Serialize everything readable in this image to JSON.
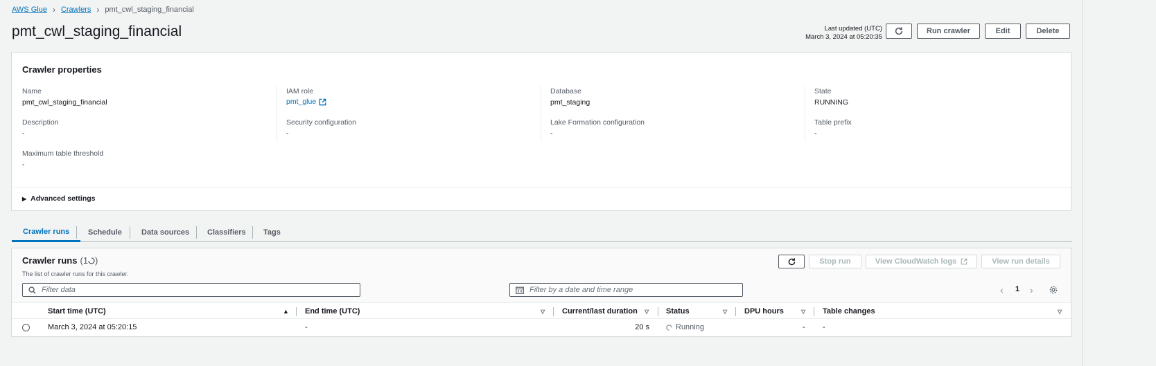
{
  "breadcrumb": {
    "root": "AWS Glue",
    "parent": "Crawlers",
    "current": "pmt_cwl_staging_financial"
  },
  "page": {
    "title": "pmt_cwl_staging_financial"
  },
  "header": {
    "last_updated_label": "Last updated (UTC)",
    "last_updated_value": "March 3, 2024 at 05:20:35",
    "run_crawler": "Run crawler",
    "edit": "Edit",
    "delete": "Delete"
  },
  "properties": {
    "title": "Crawler properties",
    "name_label": "Name",
    "name_value": "pmt_cwl_staging_financial",
    "iam_label": "IAM role",
    "iam_value": "pmt_glue",
    "db_label": "Database",
    "db_value": "pmt_staging",
    "state_label": "State",
    "state_value": "RUNNING",
    "desc_label": "Description",
    "desc_value": "-",
    "sec_label": "Security configuration",
    "sec_value": "-",
    "lf_label": "Lake Formation configuration",
    "lf_value": "-",
    "prefix_label": "Table prefix",
    "prefix_value": "-",
    "max_label": "Maximum table threshold",
    "max_value": "-",
    "advanced": "Advanced settings"
  },
  "tabs": [
    "Crawler runs",
    "Schedule",
    "Data sources",
    "Classifiers",
    "Tags"
  ],
  "runs": {
    "title": "Crawler runs",
    "count_open": "(1",
    "count_close": ")",
    "subtitle": "The list of crawler runs for this crawler.",
    "stop_run": "Stop run",
    "cloudwatch": "View CloudWatch logs",
    "details": "View run details",
    "filter_placeholder": "Filter data",
    "date_placeholder": "Filter by a date and time range",
    "page_number": "1",
    "columns": [
      "Start time (UTC)",
      "End time (UTC)",
      "Current/last duration",
      "Status",
      "DPU hours",
      "Table changes"
    ],
    "rows": [
      {
        "start": "March 3, 2024 at 05:20:15",
        "end": "-",
        "duration": "20 s",
        "status": "Running",
        "dpu": "-",
        "changes": "-"
      }
    ]
  }
}
